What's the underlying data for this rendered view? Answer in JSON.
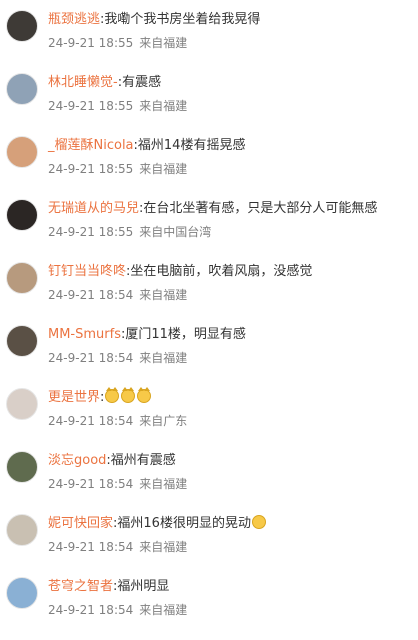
{
  "comments": [
    {
      "user": "瓶颈逃逃",
      "text": ":我嘞个我书房坐着给我晃得",
      "date": "24-9-21",
      "time": "18:55",
      "location": "来自福建",
      "avatar_color": "#3e3a36",
      "emojis": []
    },
    {
      "user": "林北睡懒觉-",
      "text": ":有震感",
      "date": "24-9-21",
      "time": "18:55",
      "location": "来自福建",
      "avatar_color": "#8fa2b6",
      "emojis": []
    },
    {
      "user": "_榴莲酥Nicola",
      "text": ":福州14楼有摇晃感",
      "date": "24-9-21",
      "time": "18:55",
      "location": "来自福建",
      "avatar_color": "#d6a07a",
      "emojis": []
    },
    {
      "user": "无瑞道从的马兒",
      "text": ":在台北坐著有感，只是大部分人可能無感",
      "date": "24-9-21",
      "time": "18:55",
      "location": "来自中国台湾",
      "avatar_color": "#2b2624",
      "emojis": []
    },
    {
      "user": "钉钉当当咚咚",
      "text": ":坐在电脑前，吹着风扇，没感觉",
      "date": "24-9-21",
      "time": "18:54",
      "location": "来自福建",
      "avatar_color": "#b79a7e",
      "emojis": []
    },
    {
      "user": "MM-Smurfs",
      "text": ":厦门11楼，明显有感",
      "date": "24-9-21",
      "time": "18:54",
      "location": "来自福建",
      "avatar_color": "#5a5045",
      "emojis": []
    },
    {
      "user": "更是世界",
      "text": ":",
      "date": "24-9-21",
      "time": "18:54",
      "location": "来自广东",
      "avatar_color": "#d9cfc8",
      "emojis": [
        "cat-face-icon",
        "cat-face-icon",
        "cat-face-icon"
      ]
    },
    {
      "user": "淡忘good",
      "text": ":福州有震感",
      "date": "24-9-21",
      "time": "18:54",
      "location": "来自福建",
      "avatar_color": "#5f6b4e",
      "emojis": []
    },
    {
      "user": "妮可快回家",
      "text": ":福州16楼很明显的晃动",
      "date": "24-9-21",
      "time": "18:54",
      "location": "来自福建",
      "avatar_color": "#c9c0b2",
      "emojis": [
        "crying-face-icon"
      ]
    },
    {
      "user": "苍穹之智者",
      "text": ":福州明显",
      "date": "24-9-21",
      "time": "18:54",
      "location": "来自福建",
      "avatar_color": "#8ab0d4",
      "emojis": []
    }
  ]
}
